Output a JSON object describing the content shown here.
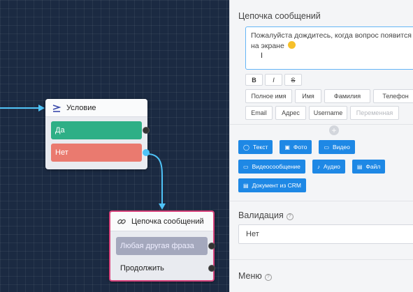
{
  "canvas": {
    "condition_node": {
      "title": "Условие",
      "options": [
        {
          "label": "Да",
          "color": "#2eaf86"
        },
        {
          "label": "Нет",
          "color": "#ea7a6f"
        }
      ]
    },
    "chain_node": {
      "title": "Цепочка сообщений",
      "options": [
        "Любая другая фраза",
        "Продолжить"
      ],
      "border_color": "#d8437c"
    },
    "wire_color": "#4fc3f7"
  },
  "panel": {
    "title": "Цепочка сообщений",
    "message_text": "Пожалуйста дождитесь, когда вопрос появится на экране",
    "cursor_glyph": "I",
    "format_buttons": [
      "B",
      "I",
      "S"
    ],
    "variables_row1": [
      "Полное имя",
      "Имя",
      "Фамилия",
      "Телефон"
    ],
    "variables_row2": [
      "Email",
      "Адрес",
      "Username",
      "Переменная"
    ],
    "add_buttons_row1": [
      {
        "label": "Текст",
        "icon": "chat-icon"
      },
      {
        "label": "Фото",
        "icon": "image-icon"
      },
      {
        "label": "Видео",
        "icon": "video-icon"
      }
    ],
    "add_buttons_row2": [
      {
        "label": "Видеосообщение",
        "icon": "video-message-icon"
      },
      {
        "label": "Аудио",
        "icon": "microphone-icon"
      },
      {
        "label": "Файл",
        "icon": "file-icon"
      }
    ],
    "add_buttons_row3": [
      {
        "label": "Документ из CRM",
        "icon": "document-icon"
      }
    ],
    "validation_label": "Валидация",
    "validation_value": "Нет",
    "menu_label": "Меню",
    "accent_color": "#1e88e5"
  }
}
